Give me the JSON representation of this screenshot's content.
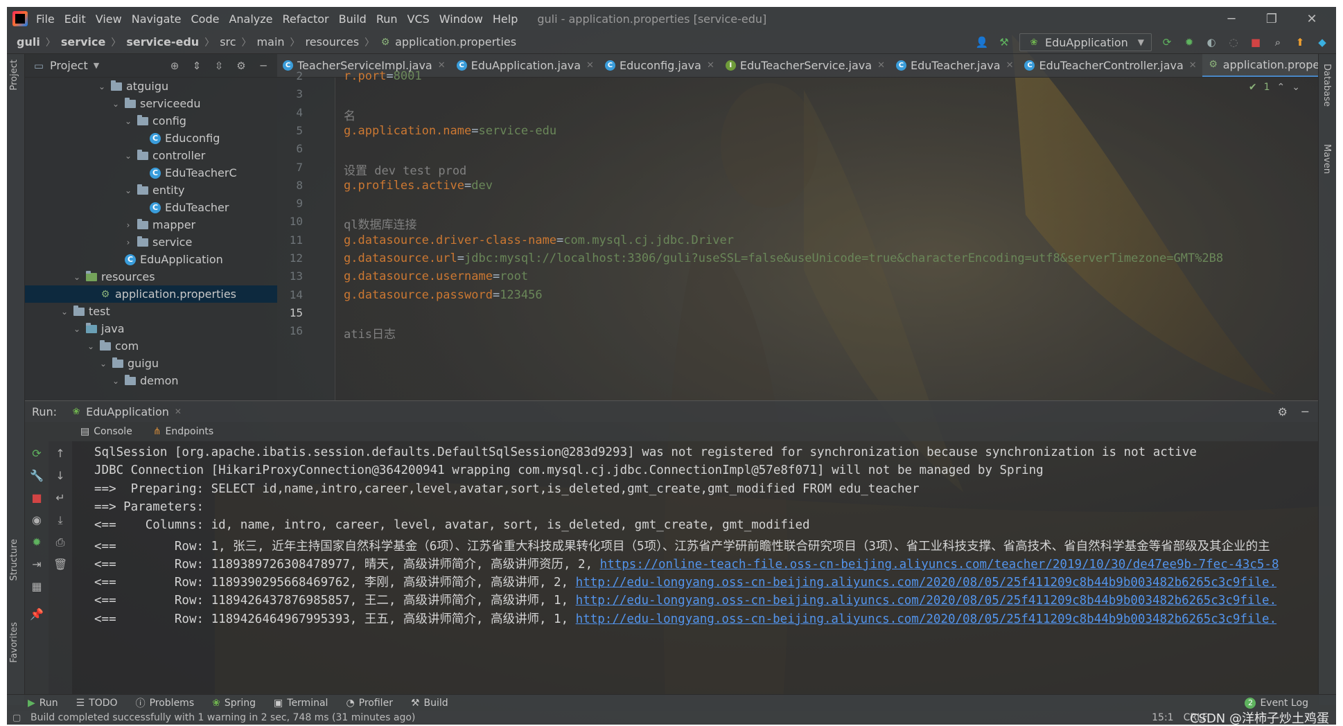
{
  "window": {
    "menu": [
      "File",
      "Edit",
      "View",
      "Navigate",
      "Code",
      "Analyze",
      "Refactor",
      "Build",
      "Run",
      "VCS",
      "Window",
      "Help"
    ],
    "title": "guli - application.properties [service-edu]",
    "controls": {
      "minimize": "─",
      "restore": "❐",
      "close": "✕"
    }
  },
  "navbar": {
    "breadcrumbs": [
      "guli",
      "service",
      "service-edu",
      "src",
      "main",
      "resources",
      "application.properties"
    ],
    "run_config": "EduApplication"
  },
  "project": {
    "title": "Project",
    "tree": [
      {
        "label": "atguigu",
        "type": "folder",
        "expanded": true
      },
      {
        "label": "serviceedu",
        "type": "folder",
        "expanded": true
      },
      {
        "label": "config",
        "type": "folder",
        "expanded": true
      },
      {
        "label": "Educonfig",
        "type": "class"
      },
      {
        "label": "controller",
        "type": "folder",
        "expanded": true
      },
      {
        "label": "EduTeacherC",
        "type": "class"
      },
      {
        "label": "entity",
        "type": "folder",
        "expanded": true
      },
      {
        "label": "EduTeacher",
        "type": "class"
      },
      {
        "label": "mapper",
        "type": "folder",
        "expanded": false
      },
      {
        "label": "service",
        "type": "folder",
        "expanded": false
      },
      {
        "label": "EduApplication",
        "type": "app"
      },
      {
        "label": "resources",
        "type": "folder",
        "expanded": true
      },
      {
        "label": "application.properties",
        "type": "props"
      },
      {
        "label": "test",
        "type": "folder",
        "expanded": true
      },
      {
        "label": "java",
        "type": "folder",
        "expanded": true
      },
      {
        "label": "com",
        "type": "folder",
        "expanded": true
      },
      {
        "label": "guigu",
        "type": "folder",
        "expanded": true
      },
      {
        "label": "demon",
        "type": "folder",
        "expanded": true
      }
    ]
  },
  "editor": {
    "tabs": [
      {
        "label": "TeacherServiceImpl.java",
        "icon": "class-icon",
        "active": false
      },
      {
        "label": "EduApplication.java",
        "icon": "app-icon",
        "active": false
      },
      {
        "label": "Educonfig.java",
        "icon": "class-icon",
        "active": false
      },
      {
        "label": "EduTeacherService.java",
        "icon": "interface-icon",
        "active": false
      },
      {
        "label": "EduTeacher.java",
        "icon": "class-icon",
        "active": false
      },
      {
        "label": "EduTeacherController.java",
        "icon": "class-icon",
        "active": false
      },
      {
        "label": "application.properties",
        "icon": "properties-icon",
        "active": true
      }
    ],
    "inspection_count": "1",
    "lines": [
      {
        "no": "2",
        "key": "r.port",
        "eq": "=",
        "val": "8001",
        "comment": ""
      },
      {
        "no": "3",
        "key": "",
        "eq": "",
        "val": "",
        "comment": ""
      },
      {
        "no": "4",
        "key": "",
        "eq": "",
        "val": "",
        "comment": "名"
      },
      {
        "no": "5",
        "key": "g.application.name",
        "eq": "=",
        "val": "service-edu",
        "comment": ""
      },
      {
        "no": "6",
        "key": "",
        "eq": "",
        "val": "",
        "comment": ""
      },
      {
        "no": "7",
        "key": "",
        "eq": "",
        "val": "",
        "comment": "设置 dev test prod"
      },
      {
        "no": "8",
        "key": "g.profiles.active",
        "eq": "=",
        "val": "dev",
        "comment": ""
      },
      {
        "no": "9",
        "key": "",
        "eq": "",
        "val": "",
        "comment": ""
      },
      {
        "no": "10",
        "key": "",
        "eq": "",
        "val": "",
        "comment": "ql数据库连接"
      },
      {
        "no": "11",
        "key": "g.datasource.driver-class-name",
        "eq": "=",
        "val": "com.mysql.cj.jdbc.Driver",
        "comment": ""
      },
      {
        "no": "12",
        "key": "g.datasource.url",
        "eq": "=",
        "val": "jdbc:mysql://localhost:3306/guli?useSSL=false&useUnicode=true&characterEncoding=utf8&serverTimezone=GMT%2B8",
        "comment": ""
      },
      {
        "no": "13",
        "key": "g.datasource.username",
        "eq": "=",
        "val": "root",
        "comment": ""
      },
      {
        "no": "14",
        "key": "g.datasource.password",
        "eq": "=",
        "val": "123456",
        "comment": ""
      },
      {
        "no": "15",
        "key": "",
        "eq": "",
        "val": "",
        "comment": ""
      },
      {
        "no": "16",
        "key": "",
        "eq": "",
        "val": "",
        "comment": "atis日志"
      }
    ]
  },
  "run": {
    "label": "Run:",
    "config_tab": "EduApplication",
    "subtabs": [
      "Console",
      "Endpoints"
    ],
    "console": [
      {
        "text": "SqlSession [org.apache.ibatis.session.defaults.DefaultSqlSession@283d9293] was not registered for synchronization because synchronization is not active",
        "link": ""
      },
      {
        "text": "JDBC Connection [HikariProxyConnection@364200941 wrapping com.mysql.cj.jdbc.ConnectionImpl@57e8f071] will not be managed by Spring",
        "link": ""
      },
      {
        "text": "==>  Preparing: SELECT id,name,intro,career,level,avatar,sort,is_deleted,gmt_create,gmt_modified FROM edu_teacher",
        "link": ""
      },
      {
        "text": "==> Parameters: ",
        "link": ""
      },
      {
        "text": "<==    Columns: id, name, intro, career, level, avatar, sort, is_deleted, gmt_create, gmt_modified",
        "link": ""
      },
      {
        "text": "<==        Row: 1, 张三, 近年主持国家自然科学基金（6项）、江苏省重大科技成果转化项目（5项）、江苏省产学研前瞻性联合研究项目（3项）、省工业科技支撑、省高技术、省自然科学基金等省部级及其企业的主",
        "link": ""
      },
      {
        "text": "<==        Row: 1189389726308478977, 晴天, 高级讲师简介, 高级讲师资历, 2, ",
        "link": "https://online-teach-file.oss-cn-beijing.aliyuncs.com/teacher/2019/10/30/de47ee9b-7fec-43c5-8"
      },
      {
        "text": "<==        Row: 1189390295668469762, 李刚, 高级讲师简介, 高级讲师, 2, ",
        "link": "http://edu-longyang.oss-cn-beijing.aliyuncs.com/2020/08/05/25f411209c8b44b9b003482b6265c3c9file."
      },
      {
        "text": "<==        Row: 1189426437876985857, 王二, 高级讲师简介, 高级讲师, 1, ",
        "link": "http://edu-longyang.oss-cn-beijing.aliyuncs.com/2020/08/05/25f411209c8b44b9b003482b6265c3c9file."
      },
      {
        "text": "<==        Row: 1189426464967995393, 王五, 高级讲师简介, 高级讲师, 1, ",
        "link": "http://edu-longyang.oss-cn-beijing.aliyuncs.com/2020/08/05/25f411209c8b44b9b003482b6265c3c9file."
      }
    ]
  },
  "bottom_tools": [
    "Run",
    "TODO",
    "Problems",
    "Spring",
    "Terminal",
    "Profiler",
    "Build"
  ],
  "event_log": {
    "count": "2",
    "label": "Event Log"
  },
  "side_tabs": {
    "left": [
      "Project",
      "Structure",
      "Favorites"
    ],
    "right": [
      "Database",
      "Maven"
    ]
  },
  "status": {
    "message": "Build completed successfully with 1 warning in 2 sec, 748 ms (31 minutes ago)",
    "position": "15:1",
    "line_sep": "CRLF",
    "watermark": "CSDN @洋柿子炒土鸡蛋"
  },
  "colors": {
    "accent": "#4a88c7",
    "key": "#cc7832",
    "value": "#6a8759",
    "link": "#5394ec"
  }
}
